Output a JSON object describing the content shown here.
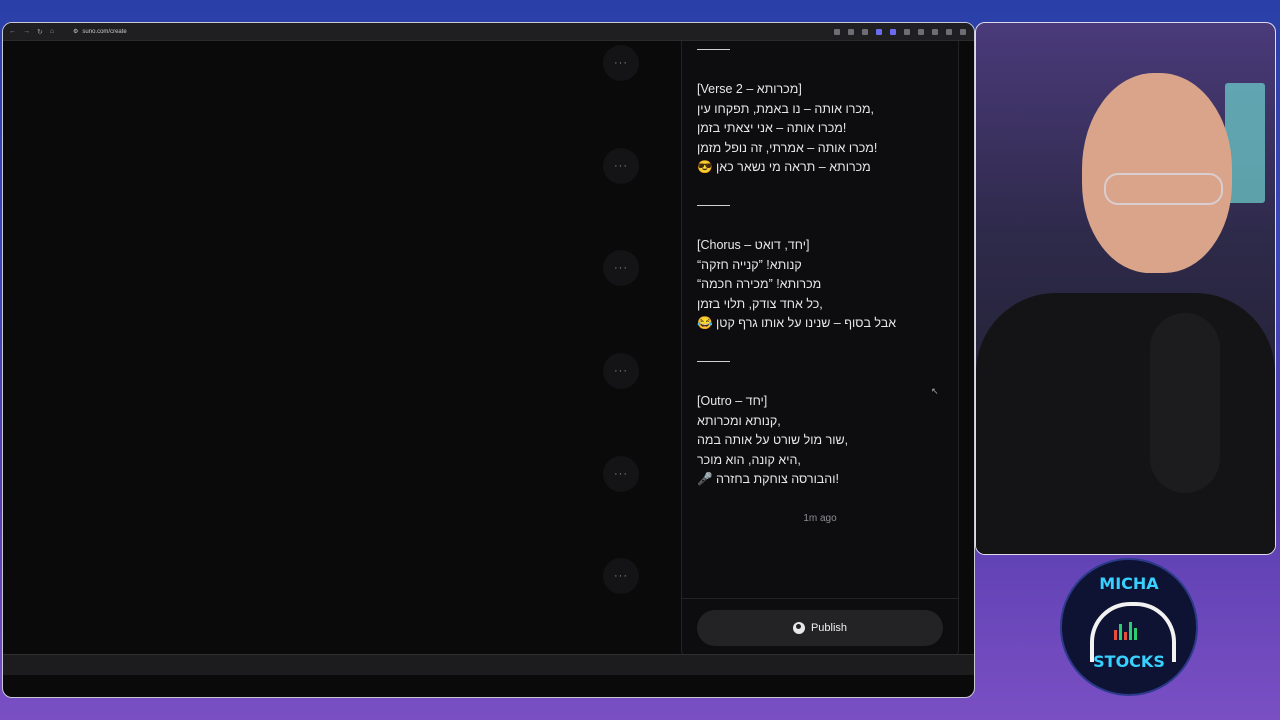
{
  "browser": {
    "url": "suno.com/create",
    "nav_icons": [
      "back-icon",
      "forward-icon",
      "reload-icon",
      "home-icon"
    ]
  },
  "song_list": {
    "more_label": "···",
    "row_count": 6
  },
  "lyrics_panel": {
    "lines": [
      {
        "kind": "sep"
      },
      {
        "kind": "gap"
      },
      {
        "kind": "text",
        "text": "[Verse 2 – מכרותא]"
      },
      {
        "kind": "text",
        "text": "מכרו אותה – נו באמת, תפקחו עין,"
      },
      {
        "kind": "text",
        "text": "מכרו אותה – אני יצאתי בזמן!"
      },
      {
        "kind": "text",
        "text": "מכרו אותה – אמרתי, זה נופל מזמן!"
      },
      {
        "kind": "text",
        "text": "😎 מכרותא – תראה מי נשאר כאן"
      },
      {
        "kind": "gap"
      },
      {
        "kind": "sep"
      },
      {
        "kind": "gap"
      },
      {
        "kind": "text",
        "text": "[Chorus – יחד, דואט]"
      },
      {
        "kind": "text",
        "text": "“קנותא! ”קנייה חזקה"
      },
      {
        "kind": "text",
        "text": "“מכרותא! ”מכירה חכמה"
      },
      {
        "kind": "text",
        "text": "כל אחד צודק, תלוי בזמן,"
      },
      {
        "kind": "text",
        "text": "😂 אבל בסוף – שנינו על אותו גרף קטן"
      },
      {
        "kind": "gap"
      },
      {
        "kind": "sep"
      },
      {
        "kind": "gap"
      },
      {
        "kind": "text",
        "text": "[Outro – יחד]"
      },
      {
        "kind": "text",
        "text": "קנותא ומכרותא,"
      },
      {
        "kind": "text",
        "text": "שור מול שורט על אותה במה,"
      },
      {
        "kind": "text",
        "text": "היא קונה, הוא מוכר,"
      },
      {
        "kind": "text",
        "text": "🎤 והבורסה צוחקת בחזרה!"
      }
    ],
    "timestamp": "1m ago",
    "publish_label": "Publish"
  },
  "overlay": {
    "logo_top": "MICHA",
    "logo_bottom": "STOCKS",
    "colors": {
      "neon": "#38d0ff",
      "background_top": "#2a3fa8",
      "background_bottom": "#7a4fc4"
    }
  }
}
